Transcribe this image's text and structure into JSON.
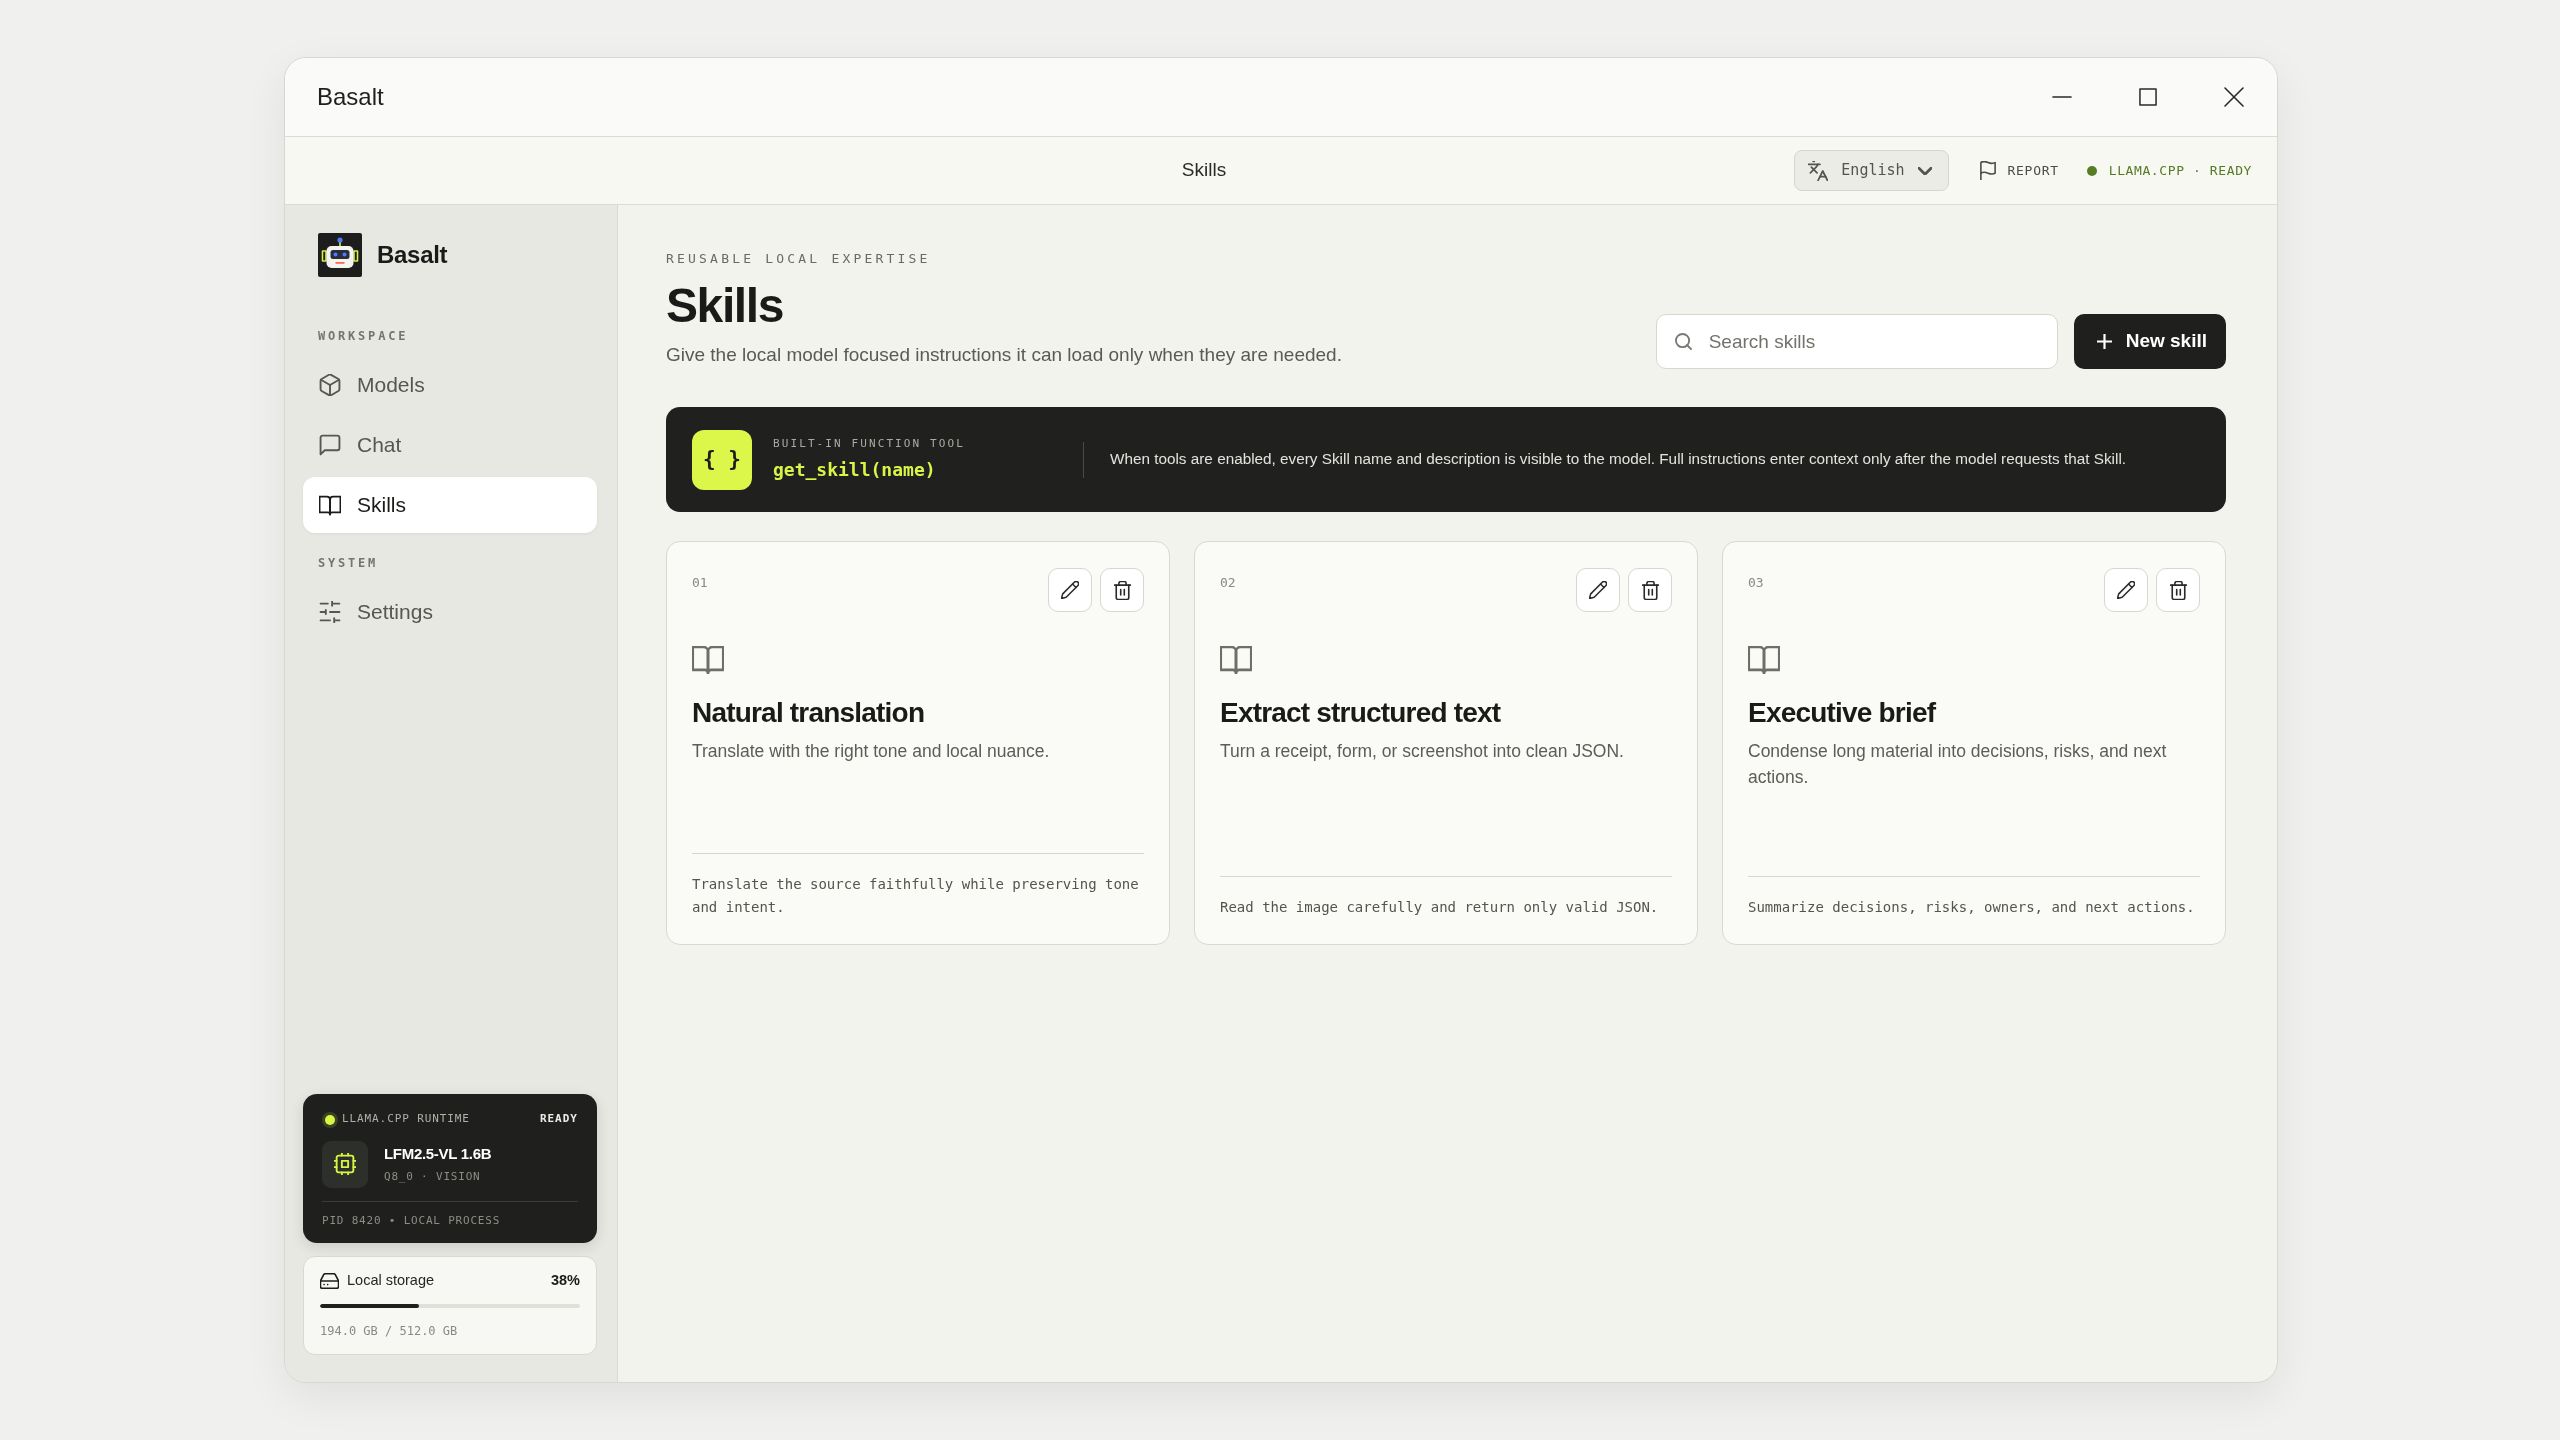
{
  "window": {
    "title": "Basalt"
  },
  "header": {
    "title": "Skills",
    "language": "English",
    "report": "REPORT",
    "runtime_status": "LLAMA.CPP · READY"
  },
  "sidebar": {
    "brand": "Basalt",
    "sections": [
      {
        "label": "WORKSPACE",
        "items": [
          {
            "label": "Models",
            "selected": false
          },
          {
            "label": "Chat",
            "selected": false
          },
          {
            "label": "Skills",
            "selected": true
          }
        ]
      },
      {
        "label": "SYSTEM",
        "items": [
          {
            "label": "Settings",
            "selected": false
          }
        ]
      }
    ],
    "runtime": {
      "label": "LLAMA.CPP RUNTIME",
      "status": "READY",
      "model": "LFM2.5-VL 1.6B",
      "details": "Q8_0 · VISION",
      "process": "PID 8420 • LOCAL PROCESS"
    },
    "storage": {
      "label": "Local storage",
      "percent": "38%",
      "level": 0.38,
      "usage": "194.0 GB / 512.0 GB"
    }
  },
  "page": {
    "eyebrow": "REUSABLE LOCAL EXPERTISE",
    "title": "Skills",
    "subtitle": "Give the local model focused instructions it can load only when they are needed.",
    "search": {
      "placeholder": "Search skills"
    },
    "new_button": "New skill"
  },
  "banner": {
    "symbol": "{ }",
    "label": "BUILT-IN FUNCTION TOOL",
    "function": "get_skill(name)",
    "text": "When tools are enabled, every Skill name and description is visible to the model. Full instructions enter context only after the model requests that Skill."
  },
  "skills": [
    {
      "number": "01",
      "title": "Natural translation",
      "description": "Translate with the right tone and local nuance.",
      "instructions": "Translate the source faithfully while preserving tone and intent."
    },
    {
      "number": "02",
      "title": "Extract structured text",
      "description": "Turn a receipt, form, or screenshot into clean JSON.",
      "instructions": "Read the image carefully and return only valid JSON."
    },
    {
      "number": "03",
      "title": "Executive brief",
      "description": "Condense long material into decisions, risks, and next actions.",
      "instructions": "Summarize decisions, risks, owners, and next actions."
    }
  ]
}
